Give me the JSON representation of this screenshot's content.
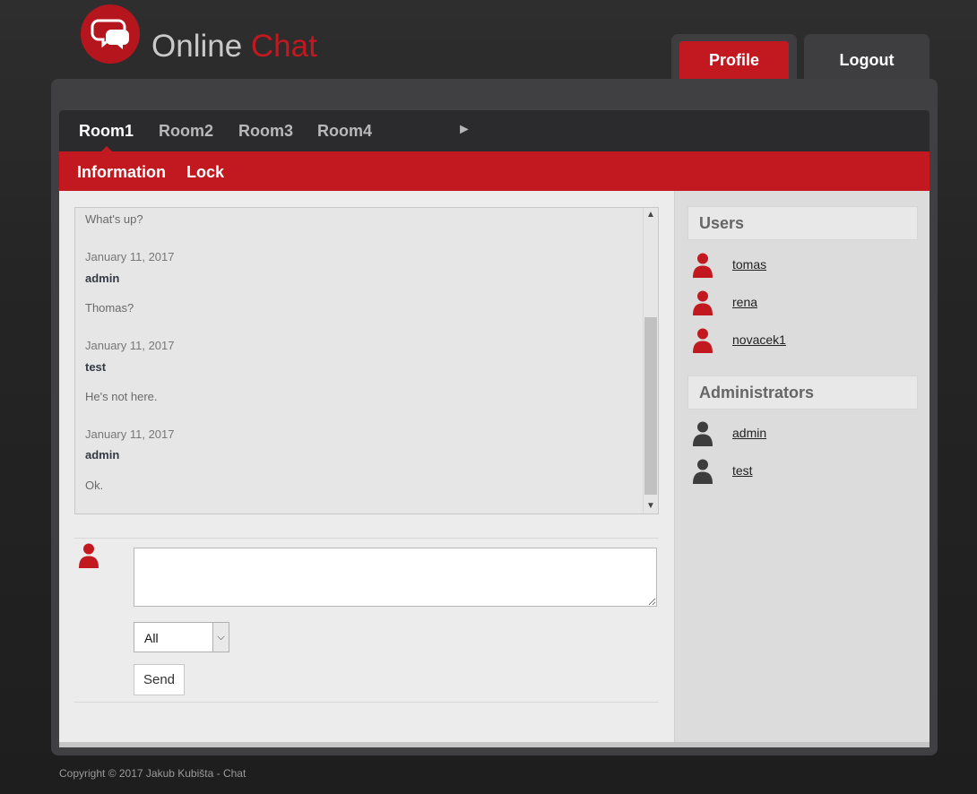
{
  "brand": {
    "word1": "Online",
    "word2": "Chat"
  },
  "header": {
    "profile_label": "Profile",
    "logout_label": "Logout"
  },
  "rooms": [
    "Room1",
    "Room2",
    "Room3",
    "Room4"
  ],
  "room_next": "►",
  "room_menu": {
    "information": "Information",
    "lock": "Lock"
  },
  "messages": [
    {
      "text": "What's up?"
    },
    {
      "date": "January 11, 2017",
      "user": "admin",
      "text": "Thomas?"
    },
    {
      "date": "January 11, 2017",
      "user": "test",
      "text": "He's not here."
    },
    {
      "date": "January 11, 2017",
      "user": "admin",
      "text": "Ok."
    }
  ],
  "composer": {
    "recipient": "All",
    "send_label": "Send",
    "message_value": ""
  },
  "sidebar": {
    "users_title": "Users",
    "users": [
      "tomas",
      "rena",
      "novacek1"
    ],
    "admins_title": "Administrators",
    "admins": [
      "admin",
      "test"
    ]
  },
  "footer": "Copyright © 2017 Jakub Kubišta - Chat",
  "colors": {
    "accent": "#c1191f",
    "dark": "#2b2b2d",
    "admin_icon": "#3d3d3d"
  }
}
